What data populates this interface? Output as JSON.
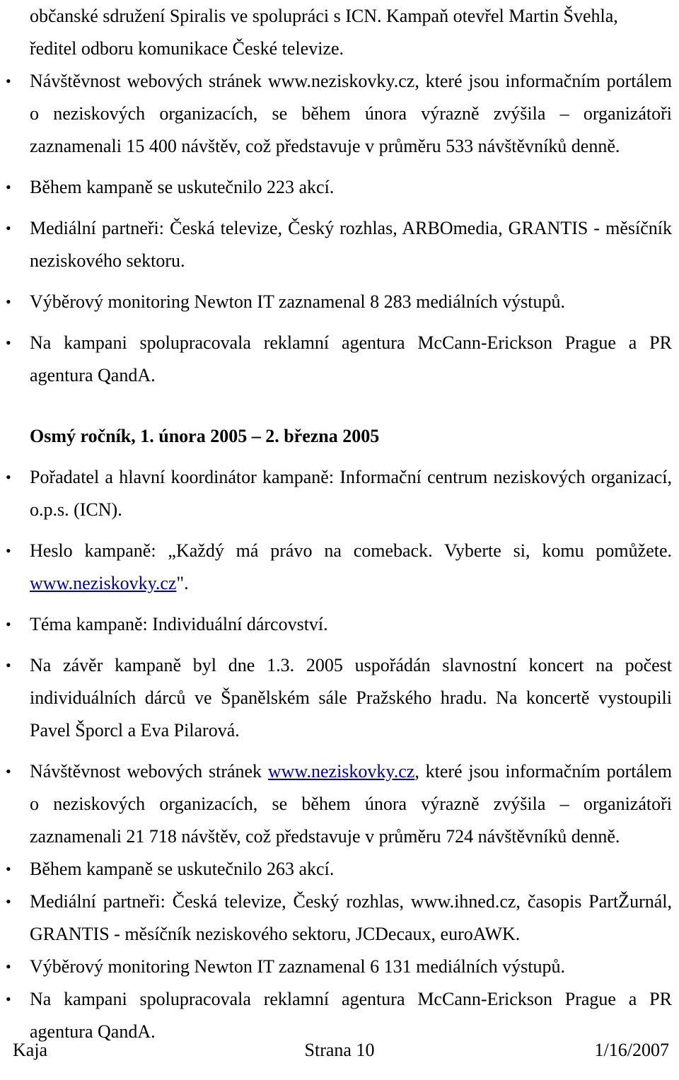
{
  "document": {
    "language": "cs",
    "page_label": "Strana 10",
    "bullet_glyph": "•"
  },
  "top_paragraph": {
    "line1": "občanské sdružení Spiralis ve spolupráci s ICN. Kampaň otevřel Martin Švehla,",
    "line2": "ředitel odboru komunikace České televize."
  },
  "first_block": {
    "bullets": [
      {
        "id": "navstevnost-2004",
        "text_before_link": "Návštěvnost webových stránek ",
        "link_text": "www.neziskovky.cz",
        "link_is_styled": false,
        "text_after_link": ", které jsou informačním portálem o neziskových organizacích, se během února výrazně zvýšila – organizátoři zaznamenali 15 400 návštěv, což představuje v průměru 533 návštěvníků denně."
      },
      {
        "id": "pocet-akci-2004",
        "text": "Během kampaně se uskutečnilo 223 akcí."
      },
      {
        "id": "medialni-partneri-2004",
        "text": "Mediální partneři: Česká televize, Český rozhlas, ARBOmedia, GRANTIS - měsíčník neziskového sektoru."
      },
      {
        "id": "monitoring-2004",
        "text": "Výběrový monitoring Newton IT zaznamenal 8 283 mediálních výstupů."
      },
      {
        "id": "agentury-2004",
        "text": "Na kampani spolupracovala reklamní agentura McCann-Erickson Prague a PR agentura QandA."
      }
    ]
  },
  "heading": {
    "text": "Osmý ročník, 1. února 2005 – 2. března 2005"
  },
  "second_block": {
    "bullets": [
      {
        "id": "poradatel-2005",
        "text": "Pořadatel a hlavní koordinátor kampaně: Informační centrum neziskových organizací, o.p.s. (ICN)."
      },
      {
        "id": "heslo-2005",
        "text_before_link": "Heslo kampaně: „Každý má právo na comeback. Vyberte si, komu pomůžete. ",
        "link_text": "www.neziskovky.cz",
        "link_is_styled": true,
        "text_after_link": "\"."
      },
      {
        "id": "tema-2005",
        "text": "Téma kampaně: Individuální dárcovství."
      },
      {
        "id": "koncert-2005",
        "text": "Na závěr kampaně byl dne 1.3. 2005 uspořádán slavnostní koncert na počest individuálních dárců ve Španělském sále Pražského hradu. Na koncertě vystoupili Pavel Šporcl a Eva Pilarová."
      },
      {
        "id": "navstevnost-2005",
        "text_before_link": "Návštěvnost webových stránek ",
        "link_text": "www.neziskovky.cz",
        "link_is_styled": true,
        "text_after_link": ", které jsou informačním portálem o neziskových organizacích, se během února výrazně zvýšila – organizátoři zaznamenali 21 718 návštěv, což představuje v průměru 724 návštěvníků denně."
      },
      {
        "id": "pocet-akci-2005",
        "text": "Během kampaně se uskutečnilo 263 akcí."
      },
      {
        "id": "medialni-partneri-2005",
        "text": "Mediální partneři: Česká televize, Český rozhlas, www.ihned.cz, časopis PartŽurnál, GRANTIS - měsíčník neziskového sektoru, JCDecaux, euroAWK."
      },
      {
        "id": "monitoring-2005",
        "text": "Výběrový monitoring Newton IT zaznamenal 6 131 mediálních výstupů."
      },
      {
        "id": "agentury-2005",
        "text": "Na kampani spolupracovala reklamní agentura McCann-Erickson Prague a PR agentura QandA."
      }
    ]
  },
  "footer": {
    "left": "Kaja",
    "center": "Strana 10",
    "right": "1/16/2007"
  },
  "colors": {
    "text": "#000000",
    "hyperlink": "#0000a0",
    "background": "#ffffff"
  }
}
